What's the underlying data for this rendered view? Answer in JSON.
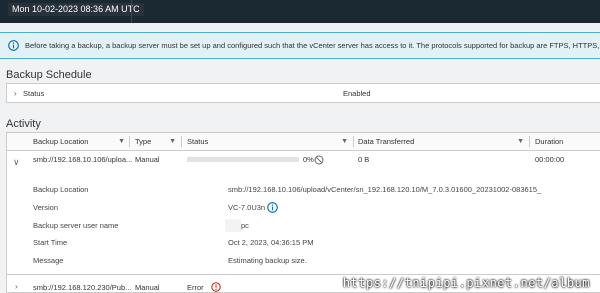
{
  "topbar": {
    "datetime": "Mon 10-02-2023 08:36 AM UTC"
  },
  "banner": {
    "text": "Before taking a backup, a backup server must be set up and configured such that the vCenter server has access to it. The protocols supported for backup are FTPS, HTTPS, SFTP, F"
  },
  "backup_schedule": {
    "title": "Backup Schedule",
    "status_label": "Status",
    "status_value": "Enabled"
  },
  "activity": {
    "title": "Activity",
    "columns": {
      "location": "Backup Location",
      "type": "Type",
      "status": "Status",
      "data": "Data Transferred",
      "duration": "Duration"
    },
    "row1": {
      "location": "smb://192.168.10.106/uploa...",
      "type": "Manual",
      "progress_text": "0%",
      "progress": 0,
      "data": "0 B",
      "duration": "00:00:00"
    },
    "details": {
      "location_label": "Backup Location",
      "location_value": "smb://192.168.10.106/upload/vCenter/sn_192.168.120.10/M_7.0.3.01600_20231002-083615_",
      "version_label": "Version",
      "version_value": "VC-7.0U3n",
      "user_label": "Backup server user name",
      "user_value": "pc",
      "start_label": "Start Time",
      "start_value": "Oct 2, 2023, 04:36:15 PM",
      "message_label": "Message",
      "message_value": "Estimating backup size."
    },
    "row2": {
      "location": "smb://192.168.120.230/Pub...",
      "type": "Manual",
      "status": "Error"
    }
  },
  "watermark": "https://tnipipi.pixnet.net/album",
  "colors": {
    "topbar": "#1b2a32",
    "banner_bg": "#e1f1f6",
    "info_blue": "#0072a3",
    "error_red": "#c92100"
  }
}
